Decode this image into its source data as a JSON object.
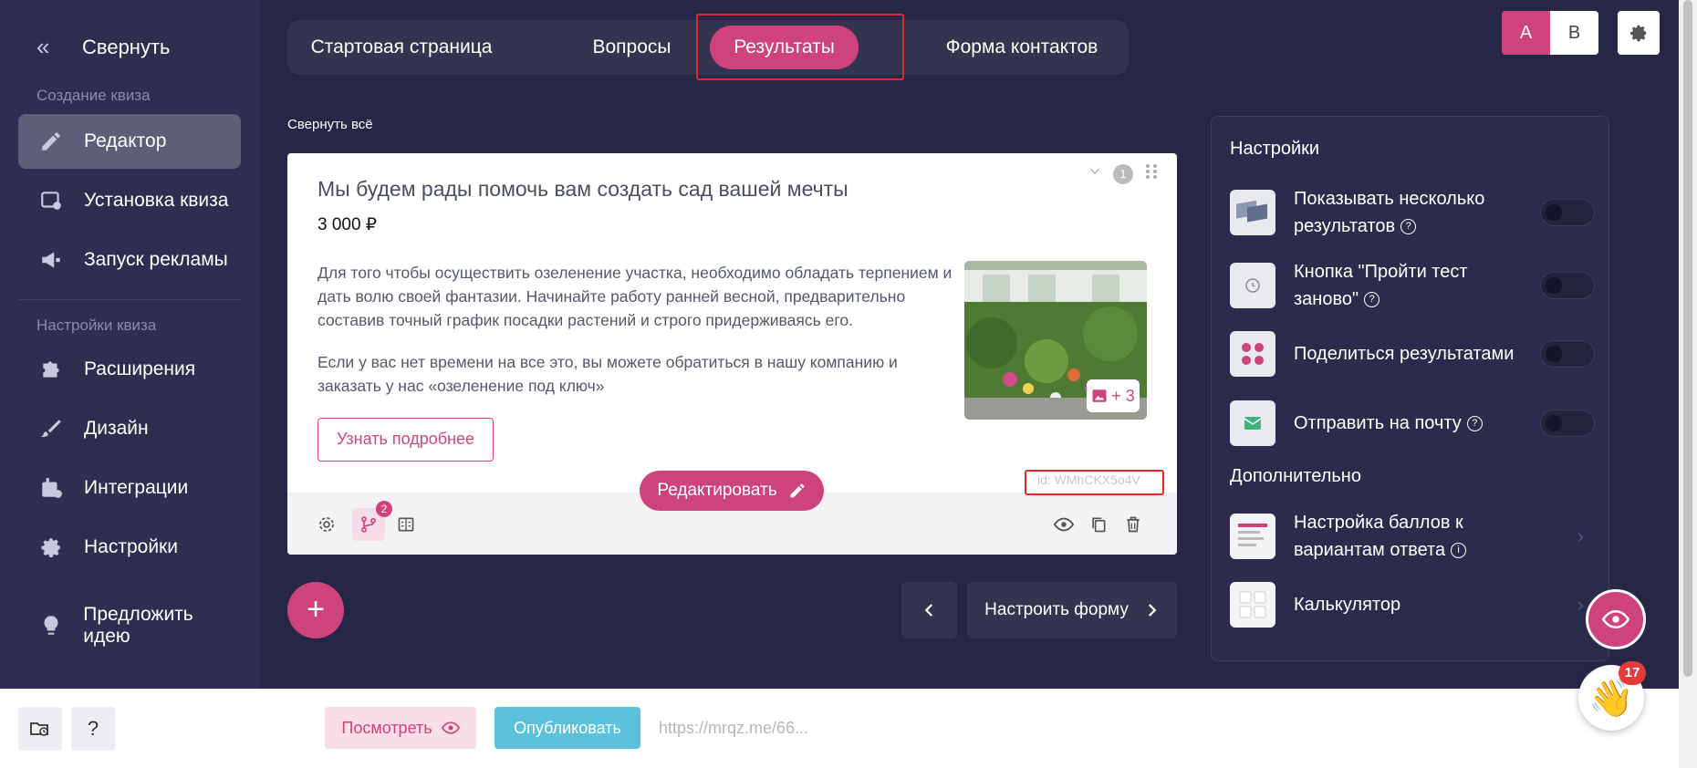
{
  "sidebar": {
    "collapse_label": "Свернуть",
    "section_create": "Создание квиза",
    "section_settings": "Настройки квиза",
    "items": [
      {
        "label": "Редактор",
        "icon": "pencil-icon",
        "active": true
      },
      {
        "label": "Установка квиза",
        "icon": "install-icon"
      },
      {
        "label": "Запуск рекламы",
        "icon": "megaphone-icon"
      },
      {
        "label": "Расширения",
        "icon": "puzzle-icon"
      },
      {
        "label": "Дизайн",
        "icon": "brush-icon"
      },
      {
        "label": "Интеграции",
        "icon": "integrations-icon"
      },
      {
        "label": "Настройки",
        "icon": "gear-icon"
      },
      {
        "label": "Предложить идею",
        "icon": "lightbulb-icon"
      }
    ]
  },
  "tabs": [
    {
      "label": "Стартовая страница"
    },
    {
      "label": "Вопросы"
    },
    {
      "label": "Результаты",
      "active": true
    },
    {
      "label": "Форма контактов"
    }
  ],
  "ab": {
    "a": "A",
    "b": "B"
  },
  "collapse_all": "Свернуть всё",
  "result_card": {
    "title": "Мы будем рады помочь вам создать сад вашей мечты",
    "price": "3 000 ₽",
    "paragraph1": "Для того чтобы осуществить озеленение участка, необходимо обладать терпением и дать волю своей фантазии. Начинайте работу ранней весной, предварительно составив точный график посадки растений и строго придерживаясь его.",
    "paragraph2": "Если у вас нет времени на все это, вы можете обратиться в нашу компанию и заказать у нас «озеленение под ключ»",
    "more_button": "Узнать подробнее",
    "image_count": "+ 3",
    "number": "1",
    "edit_button": "Редактировать",
    "id_label": "id: WMhCKX5o4V",
    "branch_count": "2"
  },
  "add_button": "+",
  "next_button": "Настроить форму",
  "settings_panel": {
    "title": "Настройки",
    "options": [
      {
        "label": "Показывать несколько результатов",
        "help": "?"
      },
      {
        "label": "Кнопка \"Пройти тест заново\"",
        "help": "?"
      },
      {
        "label": "Поделиться результатами"
      },
      {
        "label": "Отправить на почту",
        "help": "?"
      }
    ],
    "extra_title": "Дополнительно",
    "extra": [
      {
        "label": "Настройка баллов к вариантам ответа",
        "help": "i"
      },
      {
        "label": "Калькулятор"
      }
    ]
  },
  "bottom": {
    "help_label": "?",
    "view_button": "Посмотреть",
    "publish_button": "Опубликовать",
    "url": "https://mrqz.me/66..."
  },
  "notifications": {
    "count": "17"
  },
  "colors": {
    "accent": "#cf437d",
    "background": "#262747",
    "sidebar": "#2d2e50",
    "publish": "#5cc1dc"
  }
}
